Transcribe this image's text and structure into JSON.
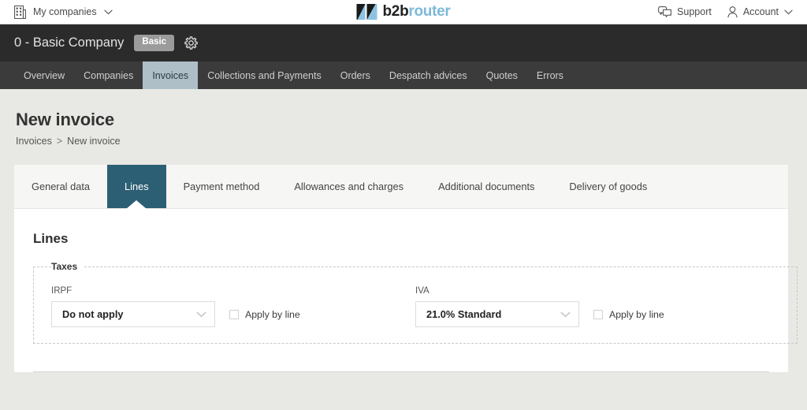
{
  "topbar": {
    "companies_label": "My companies",
    "companies_icon": "building-icon",
    "companies_chevron": "chevron-down-icon",
    "brand": {
      "first": "b2b",
      "second": "router",
      "mark": "b2brouter-logo-icon"
    },
    "support_label": "Support",
    "support_icon": "chat-bubbles-icon",
    "account_label": "Account",
    "account_icon": "user-icon",
    "account_chevron": "chevron-down-icon"
  },
  "company_bar": {
    "name": "0 - Basic Company",
    "badge": "Basic",
    "settings_icon": "gear-icon"
  },
  "main_nav": {
    "items": [
      {
        "label": "Overview",
        "active": false
      },
      {
        "label": "Companies",
        "active": false
      },
      {
        "label": "Invoices",
        "active": true
      },
      {
        "label": "Collections and Payments",
        "active": false
      },
      {
        "label": "Orders",
        "active": false
      },
      {
        "label": "Despatch advices",
        "active": false
      },
      {
        "label": "Quotes",
        "active": false
      },
      {
        "label": "Errors",
        "active": false
      }
    ]
  },
  "page": {
    "title": "New invoice",
    "breadcrumb": {
      "parent": "Invoices",
      "separator": ">",
      "current": "New invoice"
    }
  },
  "card": {
    "tabs": [
      {
        "label": "General data",
        "active": false
      },
      {
        "label": "Lines",
        "active": true
      },
      {
        "label": "Payment method",
        "active": false
      },
      {
        "label": "Allowances and charges",
        "active": false
      },
      {
        "label": "Additional documents",
        "active": false
      },
      {
        "label": "Delivery of goods",
        "active": false
      }
    ],
    "section_title": "Lines",
    "taxes": {
      "legend": "Taxes",
      "irpf": {
        "label": "IRPF",
        "value": "Do not apply",
        "chevron": "chevron-down-icon",
        "apply_by_line_label": "Apply by line",
        "apply_by_line_checked": false
      },
      "iva": {
        "label": "IVA",
        "value": "21.0% Standard",
        "chevron": "chevron-down-icon",
        "apply_by_line_label": "Apply by line",
        "apply_by_line_checked": false
      }
    }
  },
  "colors": {
    "accent": "#2d5f74",
    "nav_active": "#aebfc7",
    "header_dark": "#2b2b2b",
    "nav_dark": "#3b3b3b",
    "brand_blue": "#7cb9d8",
    "page_bg": "#e8e8e4"
  }
}
